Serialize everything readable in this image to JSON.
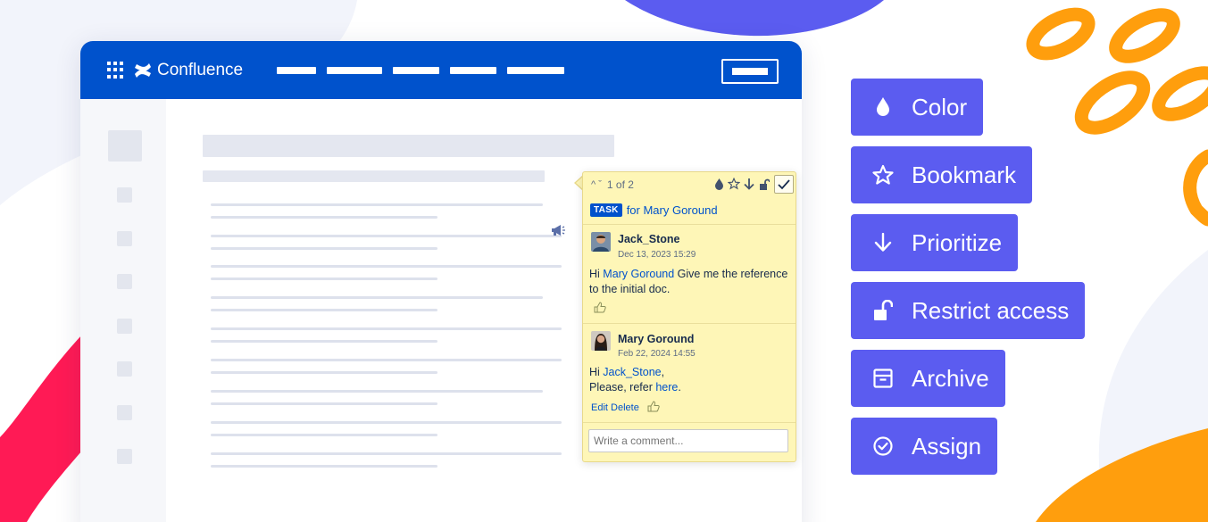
{
  "header": {
    "brand": "Confluence"
  },
  "popup": {
    "nav_arrows": "^ ˇ",
    "counter": "1 of 2",
    "task_badge": "TASK",
    "task_for": "for Mary Goround",
    "comments": [
      {
        "author": "Jack_Stone",
        "date": "Dec 13, 2023 15:29",
        "text_pre": "Hi ",
        "mention": "Mary Goround",
        "text_post": " Give me the reference to the initial doc."
      },
      {
        "author": "Mary Goround",
        "date": "Feb 22, 2024 14:55",
        "text_pre": "Hi ",
        "mention": "Jack_Stone",
        "text_mid": ",",
        "text_line2": "Please, refer ",
        "link": "here",
        "text_end": ".",
        "edit": "Edit",
        "delete": "Delete"
      }
    ],
    "comment_placeholder": "Write a comment..."
  },
  "features": [
    {
      "label": "Color",
      "icon": "drop-icon"
    },
    {
      "label": "Bookmark",
      "icon": "star-icon"
    },
    {
      "label": "Prioritize",
      "icon": "arrow-down-icon"
    },
    {
      "label": "Restrict access",
      "icon": "unlock-icon"
    },
    {
      "label": "Archive",
      "icon": "archive-icon"
    },
    {
      "label": "Assign",
      "icon": "check-circle-icon"
    }
  ],
  "colors": {
    "topbar": "#0052cc",
    "feature_button": "#5b5cf0",
    "popup_bg": "#fef6b7",
    "blob_blue": "#5b5cf0",
    "blob_orange": "#ff9e0d",
    "blob_pink": "#ff1a55",
    "link": "#0052cc"
  }
}
